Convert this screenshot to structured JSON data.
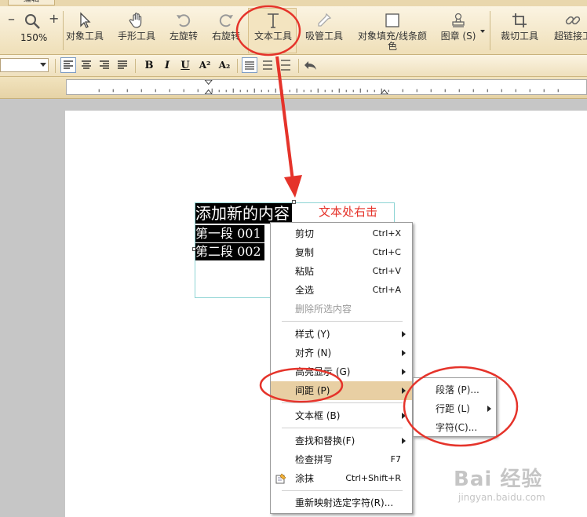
{
  "app": {
    "tab_label": "编辑",
    "zoom_level": "150%"
  },
  "toolbar": {
    "tools": [
      {
        "label": "对象工具",
        "icon": "pointer-icon"
      },
      {
        "label": "手形工具",
        "icon": "hand-icon"
      },
      {
        "label": "左旋转",
        "icon": "rotate-left-icon"
      },
      {
        "label": "右旋转",
        "icon": "rotate-right-icon"
      },
      {
        "label": "文本工具",
        "icon": "text-tool-icon"
      },
      {
        "label": "吸管工具",
        "icon": "eyedropper-icon"
      },
      {
        "label": "对象填充/线条颜色",
        "icon": "fill-color-icon"
      },
      {
        "label": "图章 (S)",
        "icon": "stamp-icon"
      },
      {
        "label": "裁切工具",
        "icon": "crop-icon"
      },
      {
        "label": "超链接工",
        "icon": "hyperlink-icon"
      }
    ]
  },
  "format_bar": {
    "font_size_value": "",
    "buttons": [
      "B",
      "I",
      "U",
      "A²",
      "A₂"
    ]
  },
  "document": {
    "line1": "添加新的内容",
    "line2": "第一段 001",
    "line3": "第二段 002",
    "hint": "文本处右击"
  },
  "context_menu": {
    "items": [
      {
        "label": "剪切",
        "shortcut": "Ctrl+X"
      },
      {
        "label": "复制",
        "shortcut": "Ctrl+C"
      },
      {
        "label": "粘贴",
        "shortcut": "Ctrl+V"
      },
      {
        "label": "全选",
        "shortcut": "Ctrl+A"
      },
      {
        "label": "删除所选内容",
        "shortcut": ""
      },
      {
        "label": "样式 (Y)",
        "shortcut": ""
      },
      {
        "label": "对齐 (N)",
        "shortcut": ""
      },
      {
        "label": "高亮显示 (G)",
        "shortcut": ""
      },
      {
        "label": "间距 (P)",
        "shortcut": ""
      },
      {
        "label": "文本框 (B)",
        "shortcut": ""
      },
      {
        "label": "查找和替换(F)",
        "shortcut": ""
      },
      {
        "label": "检查拼写",
        "shortcut": "F7"
      },
      {
        "label": "涂抹",
        "shortcut": "Ctrl+Shift+R"
      },
      {
        "label": "重新映射选定字符(R)...",
        "shortcut": ""
      }
    ]
  },
  "submenu": {
    "items": [
      {
        "label": "段落 (P)..."
      },
      {
        "label": "行距 (L)"
      },
      {
        "label": "字符(C)..."
      }
    ]
  },
  "watermark": {
    "brand": "Bai 经验",
    "url": "jingyan.baidu.com"
  },
  "colors": {
    "toolbar_bg": "#f4e7c6",
    "annotation_red": "#e5332a",
    "menu_highlight": "#e8cfa3"
  }
}
